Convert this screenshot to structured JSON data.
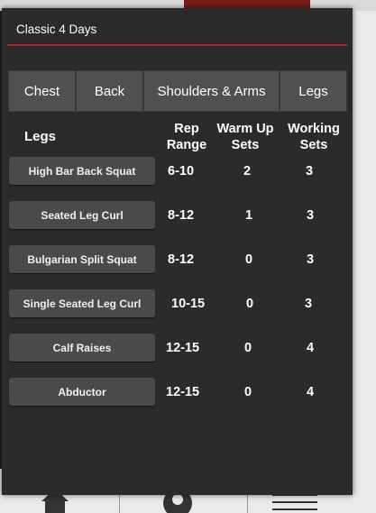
{
  "dialog": {
    "title": "Classic 4 Days"
  },
  "tabs": [
    {
      "label": "Chest"
    },
    {
      "label": "Back"
    },
    {
      "label": "Shoulders & Arms"
    },
    {
      "label": "Legs"
    }
  ],
  "table": {
    "section_label": "Legs",
    "columns": {
      "rep_range": [
        "Rep",
        "Range"
      ],
      "warm_up_sets": [
        "Warm Up",
        "Sets"
      ],
      "working_sets": [
        "Working",
        "Sets"
      ]
    },
    "rows": [
      {
        "exercise": "High Bar Back Squat",
        "rep_range": "6-10",
        "warm_up_sets": "2",
        "working_sets": "3"
      },
      {
        "exercise": "Seated Leg Curl",
        "rep_range": "8-12",
        "warm_up_sets": "1",
        "working_sets": "3"
      },
      {
        "exercise": "Bulgarian Split Squat",
        "rep_range": "8-12",
        "warm_up_sets": "0",
        "working_sets": "3"
      },
      {
        "exercise": "Single Seated Leg Curl",
        "rep_range": "10-15",
        "warm_up_sets": "0",
        "working_sets": "3"
      },
      {
        "exercise": "Calf Raises",
        "rep_range": "12-15",
        "warm_up_sets": "0",
        "working_sets": "4"
      },
      {
        "exercise": "Abductor",
        "rep_range": "12-15",
        "warm_up_sets": "0",
        "working_sets": "4"
      }
    ]
  },
  "bottom_nav": {
    "icons": [
      "home-icon",
      "profile-icon",
      "menu-icon"
    ]
  },
  "colors": {
    "accent": "#b8262b",
    "dialog_bg": "#2b2b2b",
    "button_bg": "#4a4a4a",
    "tab_bg": "#505050"
  }
}
